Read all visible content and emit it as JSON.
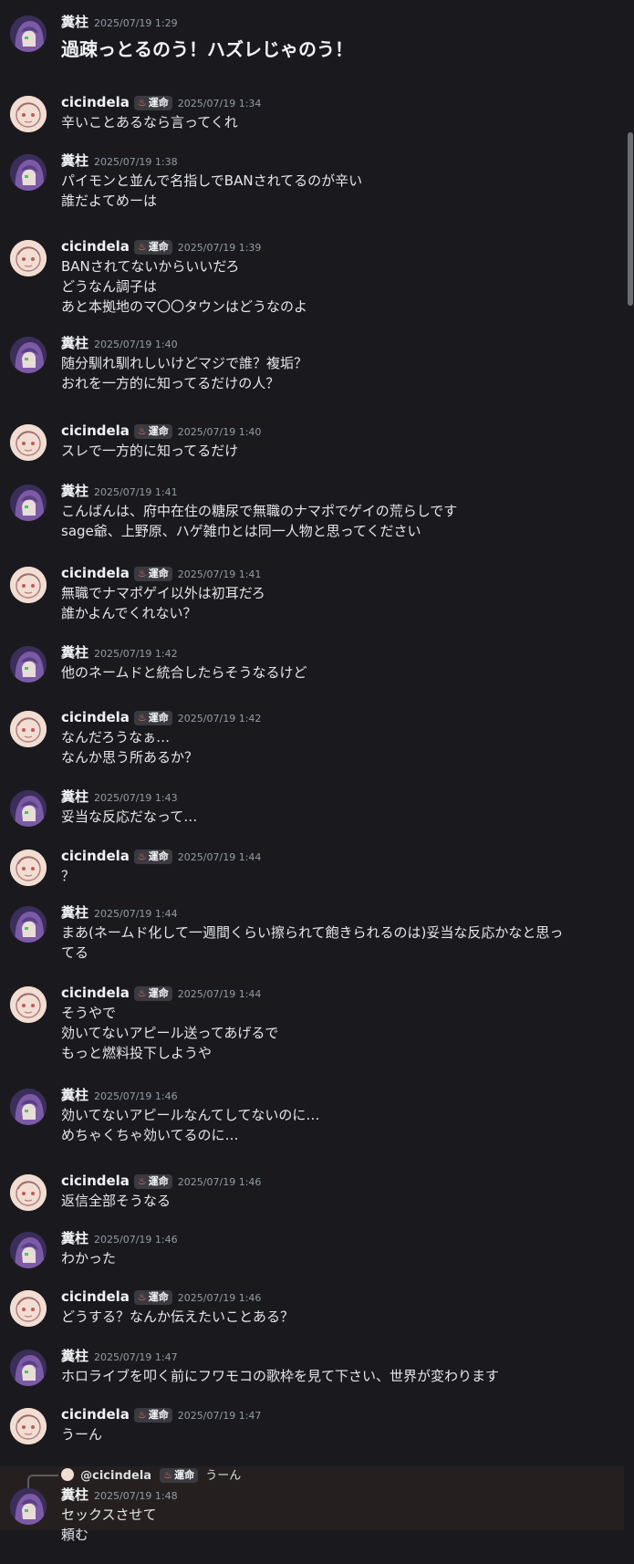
{
  "messages": [
    {
      "user": "糞柱",
      "avatar": "a",
      "badge": "",
      "time": "2025/07/19 1:29",
      "lines": [
        "過疎っとるのう！ハズレじゃのう！"
      ],
      "big": true
    },
    {
      "user": "cicindela",
      "avatar": "b",
      "badge": "運命",
      "time": "2025/07/19 1:34",
      "lines": [
        "辛いことあるなら言ってくれ"
      ]
    },
    {
      "user": "糞柱",
      "avatar": "a",
      "badge": "",
      "time": "2025/07/19 1:38",
      "lines": [
        "パイモンと並んで名指しでBANされてるのが辛い",
        "誰だよてめーは"
      ]
    },
    {
      "user": "cicindela",
      "avatar": "b",
      "badge": "運命",
      "time": "2025/07/19 1:39",
      "lines": [
        "BANされてないからいいだろ",
        "どうなん調子は",
        "あと本拠地のマ〇〇タウンはどうなのよ"
      ]
    },
    {
      "user": "糞柱",
      "avatar": "a",
      "badge": "",
      "time": "2025/07/19 1:40",
      "lines": [
        "随分馴れ馴れしいけどマジで誰？複垢？",
        "おれを一方的に知ってるだけの人？"
      ]
    },
    {
      "user": "cicindela",
      "avatar": "b",
      "badge": "運命",
      "time": "2025/07/19 1:40",
      "lines": [
        "スレで一方的に知ってるだけ"
      ]
    },
    {
      "user": "糞柱",
      "avatar": "a",
      "badge": "",
      "time": "2025/07/19 1:41",
      "lines": [
        "こんばんは、府中在住の糖尿で無職のナマポでゲイの荒らしです",
        "sage爺、上野原、ハゲ雑巾とは同一人物と思ってください"
      ]
    },
    {
      "user": "cicindela",
      "avatar": "b",
      "badge": "運命",
      "time": "2025/07/19 1:41",
      "lines": [
        "無職でナマポゲイ以外は初耳だろ",
        "誰かよんでくれない？"
      ]
    },
    {
      "user": "糞柱",
      "avatar": "a",
      "badge": "",
      "time": "2025/07/19 1:42",
      "lines": [
        "他のネームドと統合したらそうなるけど"
      ]
    },
    {
      "user": "cicindela",
      "avatar": "b",
      "badge": "運命",
      "time": "2025/07/19 1:42",
      "lines": [
        "なんだろうなぁ…",
        "なんか思う所あるか？"
      ]
    },
    {
      "user": "糞柱",
      "avatar": "a",
      "badge": "",
      "time": "2025/07/19 1:43",
      "lines": [
        "妥当な反応だなって…"
      ]
    },
    {
      "user": "cicindela",
      "avatar": "b",
      "badge": "運命",
      "time": "2025/07/19 1:44",
      "lines": [
        "？"
      ]
    },
    {
      "user": "糞柱",
      "avatar": "a",
      "badge": "",
      "time": "2025/07/19 1:44",
      "lines": [
        "まあ(ネームド化して一週間くらい擦られて飽きられるのは)妥当な反応かなと思っ",
        "てる"
      ]
    },
    {
      "user": "cicindela",
      "avatar": "b",
      "badge": "運命",
      "time": "2025/07/19 1:44",
      "lines": [
        "そうやで",
        "効いてないアピール送ってあげるで",
        "もっと燃料投下しようや"
      ]
    },
    {
      "user": "糞柱",
      "avatar": "a",
      "badge": "",
      "time": "2025/07/19 1:46",
      "lines": [
        "効いてないアピールなんてしてないのに…",
        "めちゃくちゃ効いてるのに…"
      ]
    },
    {
      "user": "cicindela",
      "avatar": "b",
      "badge": "運命",
      "time": "2025/07/19 1:46",
      "lines": [
        "返信全部そうなる"
      ]
    },
    {
      "user": "糞柱",
      "avatar": "a",
      "badge": "",
      "time": "2025/07/19 1:46",
      "lines": [
        "わかった"
      ]
    },
    {
      "user": "cicindela",
      "avatar": "b",
      "badge": "運命",
      "time": "2025/07/19 1:46",
      "lines": [
        "どうする？なんか伝えたいことある？"
      ]
    },
    {
      "user": "糞柱",
      "avatar": "a",
      "badge": "",
      "time": "2025/07/19 1:47",
      "lines": [
        "ホロライブを叩く前にフワモコの歌枠を見て下さい、世界が変わります"
      ]
    },
    {
      "user": "cicindela",
      "avatar": "b",
      "badge": "運命",
      "time": "2025/07/19 1:47",
      "lines": [
        "うーん"
      ]
    },
    {
      "user": "糞柱",
      "avatar": "a",
      "badge": "",
      "time": "2025/07/19 1:48",
      "lines": [
        "セックスさせて",
        "頼む"
      ]
    }
  ],
  "reply": {
    "mention": "@cicindela",
    "badge": "運命",
    "text": "うーん"
  },
  "colors": {
    "background": "#1a1a1e",
    "text": "#dbdee1",
    "timestamp": "#949ba4",
    "badge_bg": "#3a3a40",
    "reply_bg": "#25201f"
  }
}
